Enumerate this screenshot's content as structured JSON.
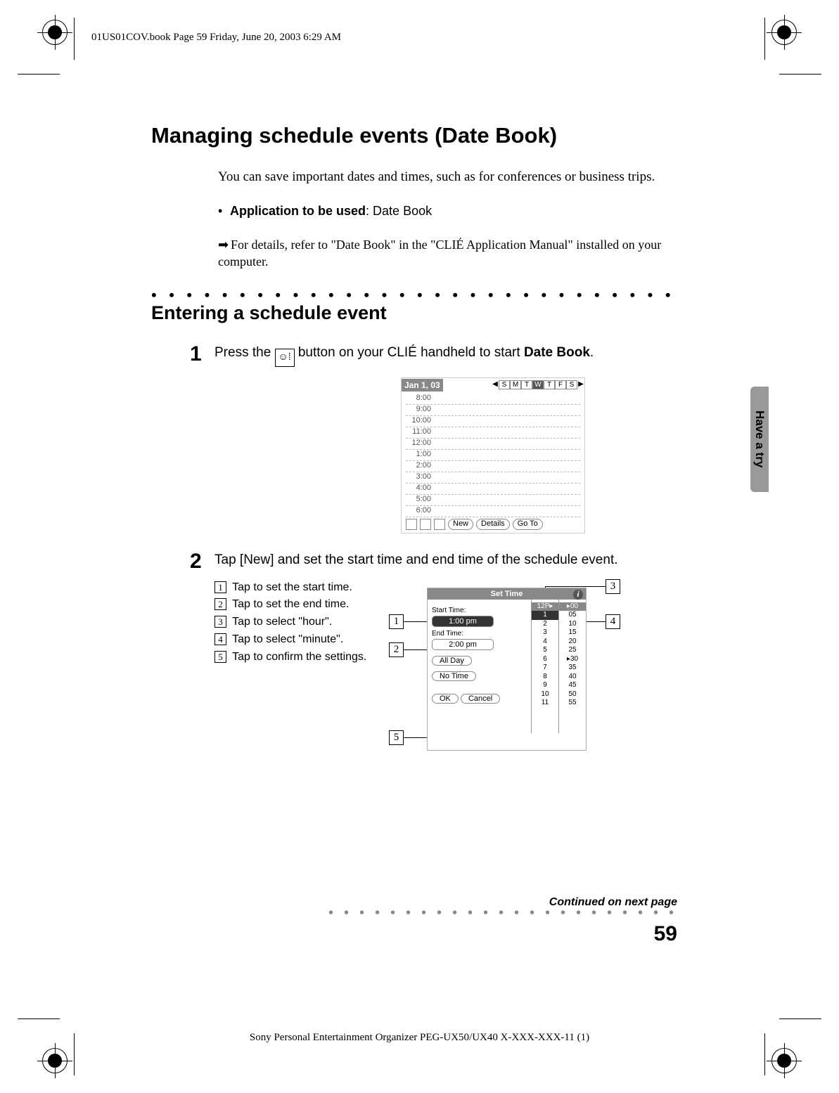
{
  "print_header": "01US01COV.book  Page 59  Friday, June 20, 2003  6:29 AM",
  "title": "Managing schedule events (Date Book)",
  "intro": "You can save important dates and times, such as for conferences or business trips.",
  "app_line_prefix": "Application to be used",
  "app_name": "Date Book",
  "note": "For details, refer to \"Date Book\" in the \"CLIÉ Application Manual\" installed on your computer.",
  "subheading": "Entering a schedule event",
  "steps": {
    "s1": {
      "num": "1",
      "text_before": "Press the ",
      "text_after": " button on your CLIÉ handheld to start ",
      "bold_tail": "Date Book",
      "period": "."
    },
    "s2": {
      "num": "2",
      "text": "Tap [New] and set the start time and end time of the schedule event."
    }
  },
  "legend": {
    "l1": "Tap to set the start time.",
    "l2": "Tap to set the end time.",
    "l3": "Tap to select \"hour\".",
    "l4": "Tap to select \"minute\".",
    "l5": "Tap to confirm the settings."
  },
  "callouts": {
    "c1": "1",
    "c2": "2",
    "c3": "3",
    "c4": "4",
    "c5": "5"
  },
  "shot1": {
    "date": "Jan 1, 03",
    "days": [
      "S",
      "M",
      "T",
      "W",
      "T",
      "F",
      "S"
    ],
    "sel_day_index": 3,
    "times": [
      "8:00",
      "9:00",
      "10:00",
      "11:00",
      "12:00",
      "1:00",
      "2:00",
      "3:00",
      "4:00",
      "5:00",
      "6:00"
    ],
    "buttons": [
      "New",
      "Details",
      "Go To"
    ]
  },
  "shot2": {
    "title": "Set Time",
    "start_label": "Start Time:",
    "start_val": "1:00 pm",
    "end_label": "End Time:",
    "end_val": "2:00 pm",
    "allday": "All Day",
    "notime": "No Time",
    "ok": "OK",
    "cancel": "Cancel",
    "hours_head": "12P▸",
    "hours": [
      "1",
      "2",
      "3",
      "4",
      "5",
      "6",
      "7",
      "8",
      "9",
      "10",
      "11"
    ],
    "mins_head": "▸00",
    "mins": [
      "05",
      "10",
      "15",
      "20",
      "25",
      "▸30",
      "35",
      "40",
      "45",
      "50",
      "55"
    ]
  },
  "side_tab": "Have a try",
  "continued": "Continued on next page",
  "page_number": "59",
  "footer": "Sony Personal Entertainment Organizer  PEG-UX50/UX40  X-XXX-XXX-11 (1)"
}
